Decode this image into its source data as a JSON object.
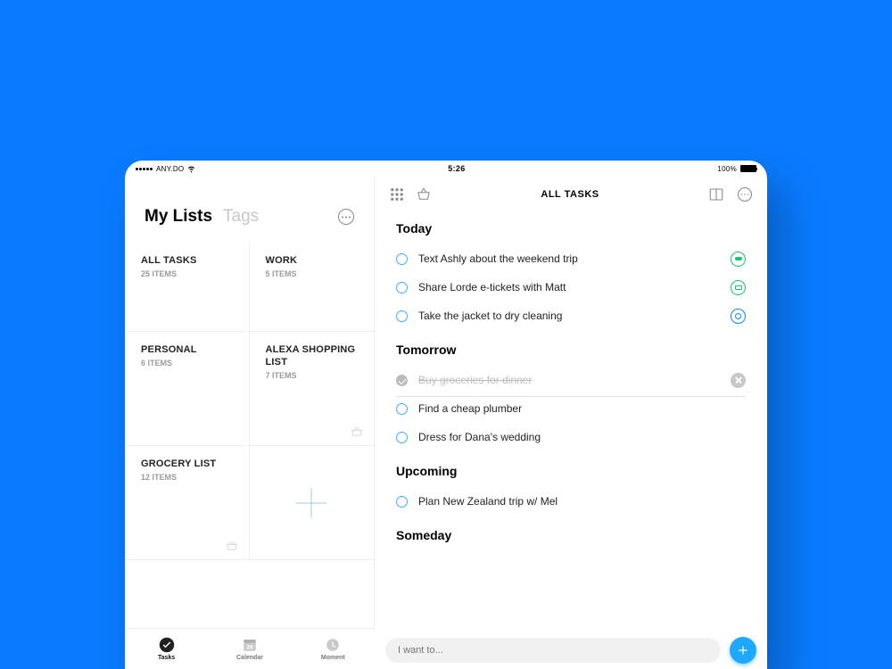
{
  "statusbar": {
    "carrier": "ANY.DO",
    "time": "5:26",
    "battery_pct": "100%"
  },
  "sidebar": {
    "title": "My Lists",
    "tab_tags": "Tags",
    "cells": [
      {
        "name": "ALL TASKS",
        "count": "25 ITEMS"
      },
      {
        "name": "WORK",
        "count": "5 ITEMS"
      },
      {
        "name": "PERSONAL",
        "count": "6 ITEMS"
      },
      {
        "name": "ALEXA SHOPPING LIST",
        "count": "7 ITEMS"
      },
      {
        "name": "GROCERY LIST",
        "count": "12 ITEMS"
      }
    ],
    "tabs": {
      "tasks": "Tasks",
      "calendar": "Calendar",
      "calendar_day": "26",
      "moment": "Moment"
    }
  },
  "main": {
    "title": "ALL TASKS",
    "sections": {
      "today": "Today",
      "tomorrow": "Tomorrow",
      "upcoming": "Upcoming",
      "someday": "Someday"
    },
    "tasks": {
      "today": [
        {
          "text": "Text Ashly about the weekend trip",
          "badge": "green-pill"
        },
        {
          "text": "Share Lorde e-tickets with Matt",
          "badge": "green-env"
        },
        {
          "text": "Take the jacket to dry cleaning",
          "badge": "blue-ring"
        }
      ],
      "tomorrow": [
        {
          "text": "Buy groceries for dinner",
          "done": true,
          "badge": "close"
        },
        {
          "text": "Find a cheap plumber"
        },
        {
          "text": "Dress for Dana's wedding"
        }
      ],
      "upcoming": [
        {
          "text": "Plan New Zealand trip w/ Mel"
        }
      ]
    },
    "composer_placeholder": "I want to..."
  }
}
